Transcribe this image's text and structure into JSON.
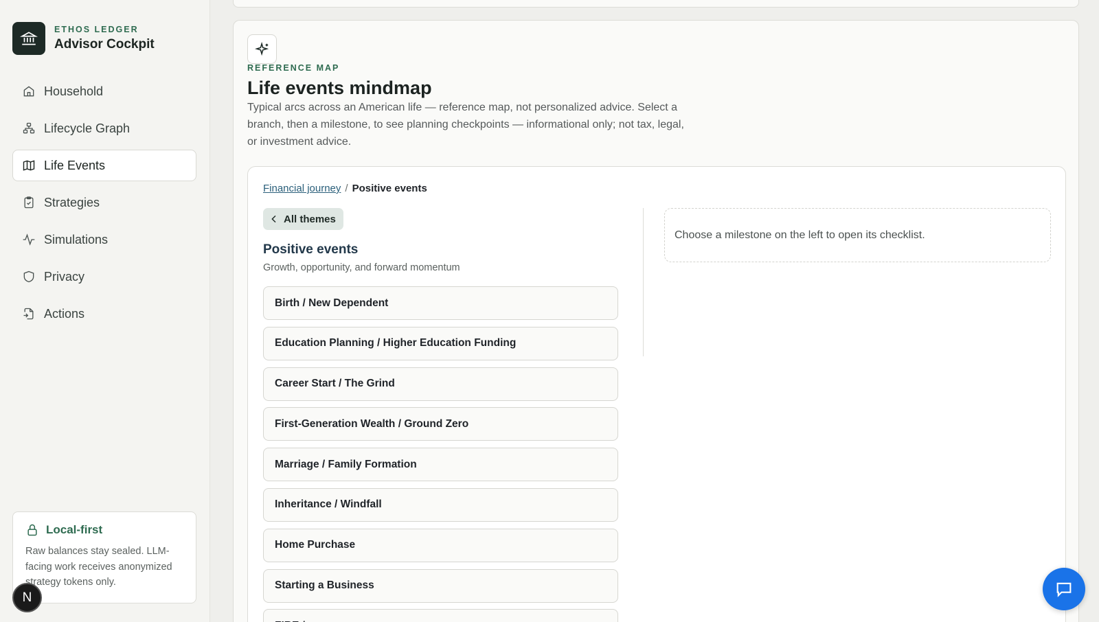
{
  "brand": {
    "kicker": "ETHOS LEDGER",
    "title": "Advisor Cockpit",
    "icon": "bank-icon"
  },
  "nav": {
    "items": [
      {
        "label": "Household",
        "icon": "home-icon"
      },
      {
        "label": "Lifecycle Graph",
        "icon": "network-icon"
      },
      {
        "label": "Life Events",
        "icon": "map-icon",
        "active": true
      },
      {
        "label": "Strategies",
        "icon": "clipboard-check-icon"
      },
      {
        "label": "Simulations",
        "icon": "activity-icon"
      },
      {
        "label": "Privacy",
        "icon": "shield-icon"
      },
      {
        "label": "Actions",
        "icon": "file-action-icon"
      }
    ]
  },
  "local_first": {
    "title": "Local-first",
    "body": "Raw balances stay sealed. LLM-facing work receives anonymized strategy tokens only."
  },
  "avatar": {
    "letter": "N"
  },
  "header": {
    "kicker": "REFERENCE MAP",
    "title": "Life events mindmap",
    "description": "Typical arcs across an American life — reference map, not personalized advice. Select a branch, then a milestone, to see planning checkpoints — informational only; not tax, legal, or investment advice."
  },
  "breadcrumb": {
    "root": "Financial journey",
    "separator": "/",
    "current": "Positive events"
  },
  "back_button": {
    "label": "All themes"
  },
  "section": {
    "title": "Positive events",
    "subtitle": "Growth, opportunity, and forward momentum"
  },
  "milestones": [
    "Birth / New Dependent",
    "Education Planning / Higher Education Funding",
    "Career Start / The Grind",
    "First-Generation Wealth / Ground Zero",
    "Marriage / Family Formation",
    "Inheritance / Windfall",
    "Home Purchase",
    "Starting a Business",
    "FIRE / ..."
  ],
  "detail": {
    "empty_message": "Choose a milestone on the left to open its checklist."
  },
  "colors": {
    "accent": "#2e6b50",
    "chat": "#1a73e8",
    "link": "#2a5f7a"
  }
}
